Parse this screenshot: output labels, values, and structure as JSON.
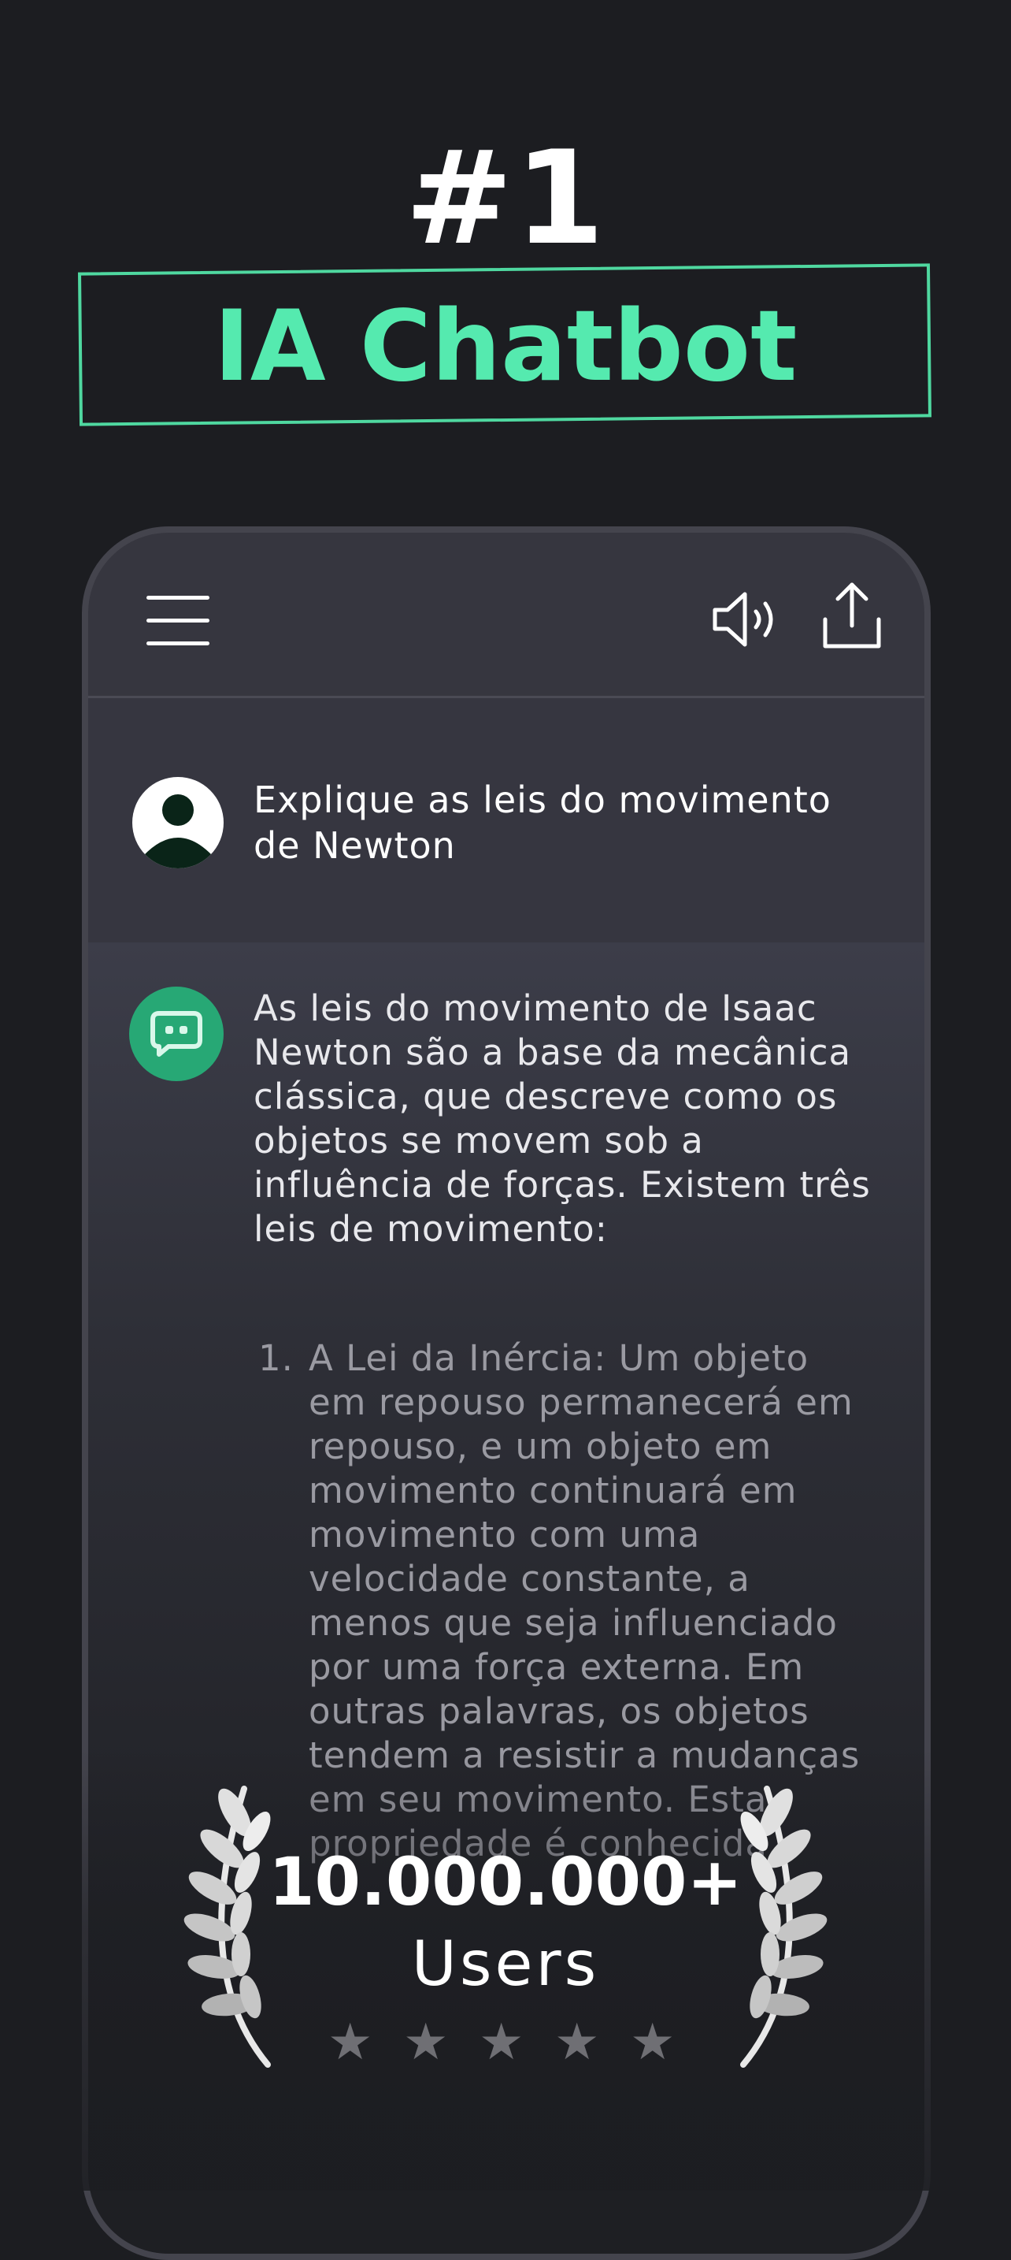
{
  "headline": {
    "rank": "#1",
    "title": "IA Chatbot"
  },
  "colors": {
    "accent": "#55eaaf",
    "background": "#1c1d21",
    "phone_body": "#36363f",
    "bot_avatar": "#27a875"
  },
  "toolbar": {
    "icons": [
      "menu-icon",
      "speaker-icon",
      "share-icon"
    ]
  },
  "chat": {
    "user_message": "Explique as leis do movimento de Newton",
    "bot_intro": "As leis do movimento de Isaac Newton são a base da mecânica clássica, que descreve como os objetos se movem sob a influência de forças. Existem três leis de movimento:",
    "bot_list": [
      {
        "number": "1.",
        "text": "A Lei da Inércia: Um objeto em repouso permanecerá em repouso, e um objeto em movimento continuará em movimento com uma velocidade constante, a menos que seja influenciado por uma força externa. Em outras palavras, os objetos tendem a resistir a mudanças em seu movimento. Esta propriedade é conhecida"
      }
    ]
  },
  "stats": {
    "users_count": "10.000.000+",
    "users_label": "Users",
    "rating_stars": 5
  }
}
